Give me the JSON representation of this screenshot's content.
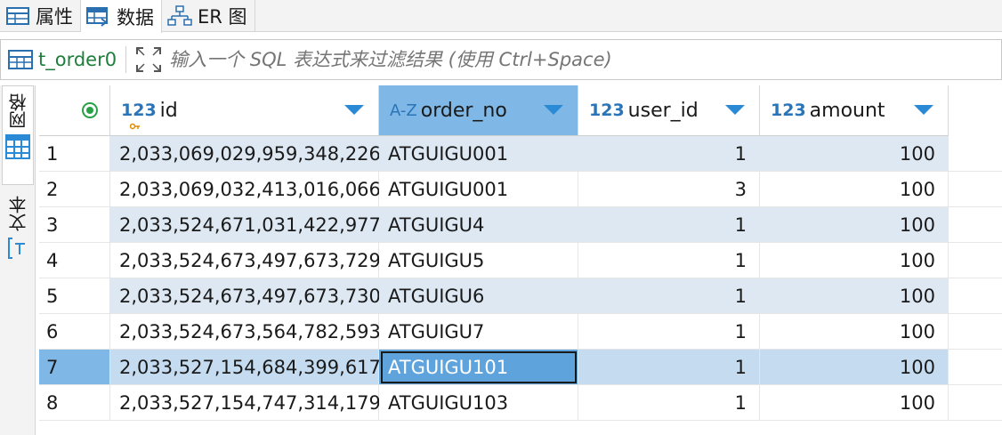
{
  "tabs": [
    {
      "label": "属性",
      "icon": "properties-icon"
    },
    {
      "label": "数据",
      "icon": "data-grid-icon"
    },
    {
      "label": "ER 图",
      "icon": "er-diagram-icon"
    }
  ],
  "filter": {
    "table_name": "t_order0",
    "placeholder": "输入一个 SQL 表达式来过滤结果 (使用 Ctrl+Space)"
  },
  "side_panel": {
    "grid_label": "网格",
    "text_label": "文本"
  },
  "columns": [
    {
      "type": "123",
      "name": "id"
    },
    {
      "type": "A-Z",
      "name": "order_no"
    },
    {
      "type": "123",
      "name": "user_id"
    },
    {
      "type": "123",
      "name": "amount"
    }
  ],
  "rows": [
    {
      "num": "1",
      "id": "2,033,069,029,959,348,226",
      "order_no": "ATGUIGU001",
      "user_id": "1",
      "amount": "100"
    },
    {
      "num": "2",
      "id": "2,033,069,032,413,016,066",
      "order_no": "ATGUIGU001",
      "user_id": "3",
      "amount": "100"
    },
    {
      "num": "3",
      "id": "2,033,524,671,031,422,977",
      "order_no": "ATGUIGU4",
      "user_id": "1",
      "amount": "100"
    },
    {
      "num": "4",
      "id": "2,033,524,673,497,673,729",
      "order_no": "ATGUIGU5",
      "user_id": "1",
      "amount": "100"
    },
    {
      "num": "5",
      "id": "2,033,524,673,497,673,730",
      "order_no": "ATGUIGU6",
      "user_id": "1",
      "amount": "100"
    },
    {
      "num": "6",
      "id": "2,033,524,673,564,782,593",
      "order_no": "ATGUIGU7",
      "user_id": "1",
      "amount": "100"
    },
    {
      "num": "7",
      "id": "2,033,527,154,684,399,617",
      "order_no": "ATGUIGU101",
      "user_id": "1",
      "amount": "100"
    },
    {
      "num": "8",
      "id": "2,033,527,154,747,314,179",
      "order_no": "ATGUIGU103",
      "user_id": "1",
      "amount": "100"
    }
  ],
  "colors": {
    "alt_row": "#dde8f3",
    "selected_row": "#c5dcf0",
    "selected_rownum": "#7fb8e6",
    "selected_header": "#7fb8e6",
    "focused_cell": "#5fa3dc",
    "table_name": "#1e7f3c",
    "accent": "#2a8ad6"
  }
}
